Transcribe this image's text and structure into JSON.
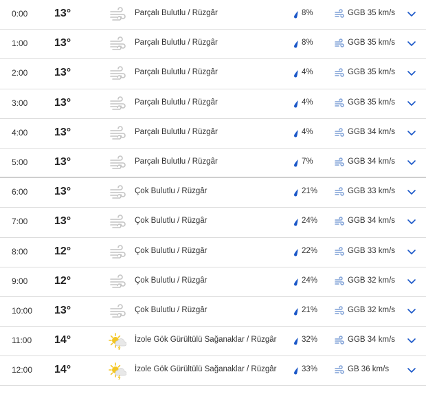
{
  "colors": {
    "accent": "#1a57c8",
    "wind_icon": "#7d9fd6",
    "sun": "#f3c623",
    "cloud": "#c4c4c4",
    "divider": "#dcdcdc"
  },
  "rows": [
    {
      "time": "0:00",
      "temp": "13°",
      "icon": "wind-icon",
      "condition": "Parçalı Bulutlu / Rüzgâr",
      "precip": "8%",
      "wind": "GGB 35 km/s"
    },
    {
      "time": "1:00",
      "temp": "13°",
      "icon": "wind-icon",
      "condition": "Parçalı Bulutlu / Rüzgâr",
      "precip": "8%",
      "wind": "GGB 35 km/s"
    },
    {
      "time": "2:00",
      "temp": "13°",
      "icon": "wind-icon",
      "condition": "Parçalı Bulutlu / Rüzgâr",
      "precip": "4%",
      "wind": "GGB 35 km/s"
    },
    {
      "time": "3:00",
      "temp": "13°",
      "icon": "wind-icon",
      "condition": "Parçalı Bulutlu / Rüzgâr",
      "precip": "4%",
      "wind": "GGB 35 km/s"
    },
    {
      "time": "4:00",
      "temp": "13°",
      "icon": "wind-icon",
      "condition": "Parçalı Bulutlu / Rüzgâr",
      "precip": "4%",
      "wind": "GGB 34 km/s"
    },
    {
      "time": "5:00",
      "temp": "13°",
      "icon": "wind-icon",
      "condition": "Parçalı Bulutlu / Rüzgâr",
      "precip": "7%",
      "wind": "GGB 34 km/s"
    },
    {
      "time": "6:00",
      "temp": "13°",
      "icon": "wind-icon",
      "condition": "Çok Bulutlu / Rüzgâr",
      "precip": "21%",
      "wind": "GGB 33 km/s"
    },
    {
      "time": "7:00",
      "temp": "13°",
      "icon": "wind-icon",
      "condition": "Çok Bulutlu / Rüzgâr",
      "precip": "24%",
      "wind": "GGB 34 km/s"
    },
    {
      "time": "8:00",
      "temp": "12°",
      "icon": "wind-icon",
      "condition": "Çok Bulutlu / Rüzgâr",
      "precip": "22%",
      "wind": "GGB 33 km/s"
    },
    {
      "time": "9:00",
      "temp": "12°",
      "icon": "wind-icon",
      "condition": "Çok Bulutlu / Rüzgâr",
      "precip": "24%",
      "wind": "GGB 32 km/s"
    },
    {
      "time": "10:00",
      "temp": "13°",
      "icon": "wind-icon",
      "condition": "Çok Bulutlu / Rüzgâr",
      "precip": "21%",
      "wind": "GGB 32 km/s"
    },
    {
      "time": "11:00",
      "temp": "14°",
      "icon": "storm-icon",
      "condition": "İzole Gök Gürültülü Sağanaklar / Rüzgâr",
      "precip": "32%",
      "wind": "GGB 34 km/s"
    },
    {
      "time": "12:00",
      "temp": "14°",
      "icon": "storm-icon",
      "condition": "İzole Gök Gürültülü Sağanaklar / Rüzgâr",
      "precip": "33%",
      "wind": "GB 36 km/s"
    }
  ]
}
